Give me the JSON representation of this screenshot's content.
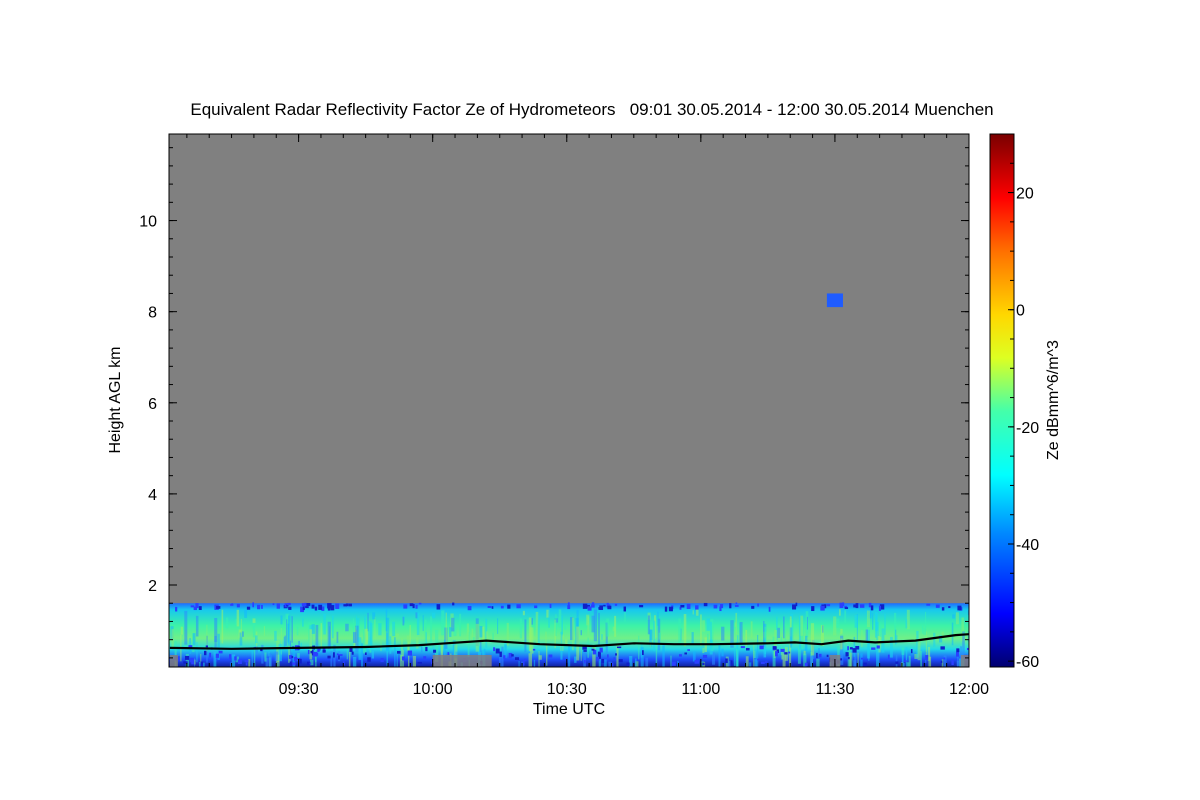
{
  "chart_data": {
    "type": "heatmap",
    "title": "Equivalent Radar Reflectivity Factor Ze of Hydrometeors   09:01 30.05.2014 - 12:00 30.05.2014 Muenchen",
    "xlabel": "Time UTC",
    "ylabel": "Height AGL km",
    "colorbar_label": "Ze dBmm^6/m^3",
    "x_range_hours": [
      9.0167,
      12.0
    ],
    "x_ticks": [
      {
        "value": 9.5,
        "label": "09:30"
      },
      {
        "value": 10.0,
        "label": "10:00"
      },
      {
        "value": 10.5,
        "label": "10:30"
      },
      {
        "value": 11.0,
        "label": "11:00"
      },
      {
        "value": 11.5,
        "label": "11:30"
      },
      {
        "value": 12.0,
        "label": "12:00"
      }
    ],
    "ylim_km": [
      0.2,
      11.9
    ],
    "y_ticks": [
      {
        "value": 2,
        "label": "2"
      },
      {
        "value": 4,
        "label": "4"
      },
      {
        "value": 6,
        "label": "6"
      },
      {
        "value": 8,
        "label": "8"
      },
      {
        "value": 10,
        "label": "10"
      }
    ],
    "colorbar_range": [
      -61,
      30
    ],
    "colorbar_ticks": [
      {
        "value": 20,
        "label": "20"
      },
      {
        "value": 0,
        "label": "0"
      },
      {
        "value": -20,
        "label": "-20"
      },
      {
        "value": -40,
        "label": "-40"
      },
      {
        "value": -60,
        "label": "-60"
      }
    ],
    "no_data_color": "#808080",
    "echo_layer": {
      "description": "low-level reflectivity layer near ground",
      "top_km_approx": 1.6,
      "typical_ze_dbz": [
        -45,
        -10
      ]
    },
    "isolated_echo": {
      "time_hours": [
        11.47,
        11.53
      ],
      "height_km": [
        8.1,
        8.4
      ],
      "ze_dbz_approx": -42
    },
    "cloud_base_line": {
      "color": "#000000",
      "points": [
        [
          9.02,
          0.62
        ],
        [
          9.25,
          0.6
        ],
        [
          9.5,
          0.62
        ],
        [
          9.75,
          0.64
        ],
        [
          9.95,
          0.68
        ],
        [
          10.05,
          0.72
        ],
        [
          10.2,
          0.78
        ],
        [
          10.4,
          0.7
        ],
        [
          10.6,
          0.66
        ],
        [
          10.75,
          0.72
        ],
        [
          10.9,
          0.7
        ],
        [
          11.05,
          0.7
        ],
        [
          11.25,
          0.72
        ],
        [
          11.35,
          0.74
        ],
        [
          11.45,
          0.7
        ],
        [
          11.55,
          0.78
        ],
        [
          11.65,
          0.74
        ],
        [
          11.8,
          0.78
        ],
        [
          11.95,
          0.9
        ],
        [
          12.0,
          0.92
        ]
      ]
    }
  }
}
